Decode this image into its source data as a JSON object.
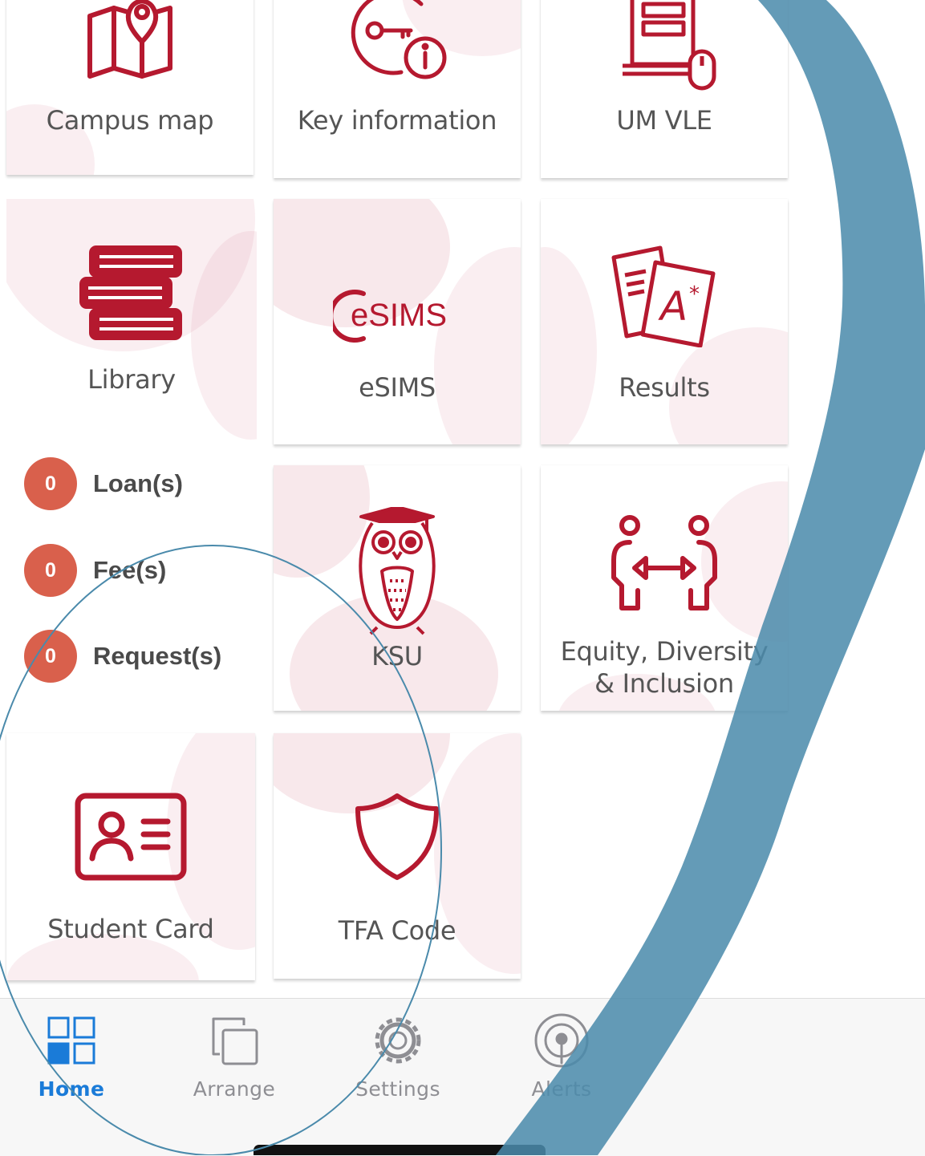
{
  "tiles": {
    "campus_map": "Campus map",
    "key_information": "Key information",
    "um_vle": "UM VLE",
    "library": "Library",
    "esims": "eSIMS",
    "esims_logo": "eSIMS",
    "results": "Results",
    "ksu": "KSU",
    "edi_line1": "Equity, Diversity",
    "edi_line2": "& Inclusion",
    "student_card": "Student Card",
    "tfa_code": "TFA Code"
  },
  "counters": {
    "loans": {
      "count": "0",
      "label": "Loan(s)"
    },
    "fees": {
      "count": "0",
      "label": "Fee(s)"
    },
    "requests": {
      "count": "0",
      "label": "Request(s)"
    }
  },
  "tabbar": {
    "home": "Home",
    "arrange": "Arrange",
    "settings": "Settings",
    "alerts": "Alerts"
  },
  "icons": {
    "campus_map": "map-pin-icon",
    "key_information": "key-info-icon",
    "um_vle": "document-mouse-icon",
    "library": "books-icon",
    "results": "graded-papers-icon",
    "ksu": "owl-icon",
    "edi": "people-exchange-icon",
    "student_card": "id-card-icon",
    "tfa_code": "shield-icon",
    "home": "grid-icon",
    "arrange": "copy-icon",
    "settings": "gear-icon",
    "alerts": "broadcast-icon"
  },
  "colors": {
    "brand_red": "#b5192f",
    "badge": "#d9604c",
    "tab_active": "#1a7bd8",
    "tab_inactive": "#8e8e93",
    "annotation_blue": "#4a8aab"
  }
}
